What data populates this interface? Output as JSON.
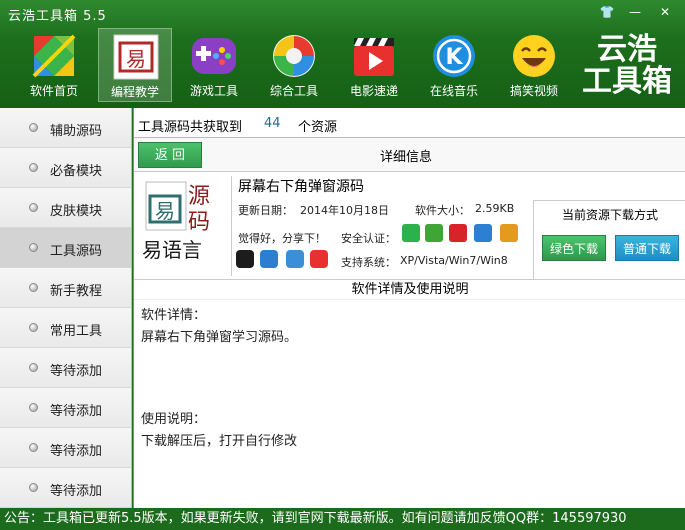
{
  "window": {
    "title": "云浩工具箱 5.5"
  },
  "nav": [
    {
      "label": "软件首页",
      "icon": "windows-logo-icon"
    },
    {
      "label": "编程教学",
      "icon": "easy-language-icon",
      "active": true
    },
    {
      "label": "游戏工具",
      "icon": "gamepad-icon"
    },
    {
      "label": "综合工具",
      "icon": "colorful-ring-icon"
    },
    {
      "label": "电影速递",
      "icon": "clapperboard-icon"
    },
    {
      "label": "在线音乐",
      "icon": "kugou-music-icon"
    },
    {
      "label": "搞笑视频",
      "icon": "laughing-face-icon"
    }
  ],
  "brand": {
    "line1": "云浩",
    "line2": "工具箱"
  },
  "sidebar": [
    {
      "label": "辅助源码"
    },
    {
      "label": "必备模块"
    },
    {
      "label": "皮肤模块"
    },
    {
      "label": "工具源码",
      "active": true
    },
    {
      "label": "新手教程"
    },
    {
      "label": "常用工具"
    },
    {
      "label": "等待添加"
    },
    {
      "label": "等待添加"
    },
    {
      "label": "等待添加"
    },
    {
      "label": "等待添加"
    }
  ],
  "main": {
    "count_prefix": "工具源码共获取到",
    "count_value": "44",
    "count_suffix": "个资源",
    "back_label": "返 回",
    "detail_title": "详细信息"
  },
  "resource": {
    "logo_text_top": "源",
    "logo_text_mid": "码",
    "logo_text_bottom": "易语言",
    "name": "屏幕右下角弹窗源码",
    "update_label": "更新日期：",
    "update_date": "2014年10月18日",
    "size_label": "软件大小：",
    "size_value": "2.59KB",
    "share_text": "觉得好，分享下！",
    "security_label": "安全认证：",
    "os_label": "支持系统：",
    "os_value": "XP/Vista/Win7/Win8"
  },
  "download": {
    "title": "当前资源下载方式",
    "green_label": "绿色下载",
    "normal_label": "普通下载"
  },
  "description": {
    "section_title": "软件详情及使用说明",
    "detail_heading": "软件详情：",
    "detail_text": "屏幕右下角弹窗学习源码。",
    "usage_heading": "使用说明：",
    "usage_text": "下载解压后，打开自行修改"
  },
  "status": {
    "text": "公告：工具箱已更新5.5版本，如果更新失败，请到官网下载最新版。如有问题请加反馈QQ群：145597930"
  },
  "colors": {
    "primary_green": "#1d6f1d",
    "count_blue": "#1b6e9c",
    "green_button": "#2f9b4d",
    "blue_button": "#1e8fc2"
  }
}
